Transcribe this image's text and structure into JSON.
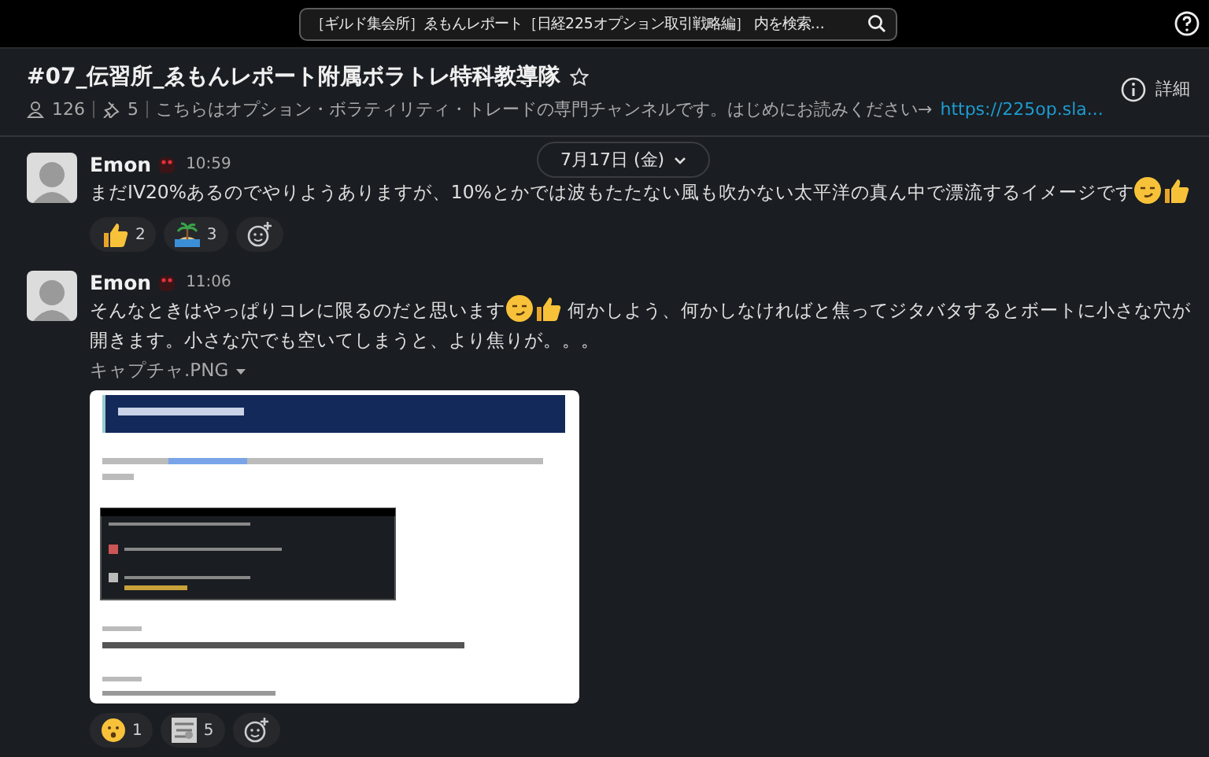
{
  "search": {
    "placeholder": "［ギルド集会所］ゑもんレポート［日経225オプション取引戦略編］ 内を検索..."
  },
  "channel": {
    "name": "#07_伝習所_ゑもんレポート附属ボラトレ特科教導隊",
    "starred": false,
    "members": "126",
    "pins": "5",
    "description": "こちらはオプション・ボラティリティ・トレードの専門チャンネルです。はじめにお読みください→",
    "link": "https://225op.sla...",
    "details_label": "詳細"
  },
  "date_divider": "7月17日 (金)",
  "messages": [
    {
      "author": "Emon",
      "time": "10:59",
      "segments": [
        {
          "kind": "text",
          "text": "まだIV20%あるのでやりようありますが、10%とかでは波もたたない風も吹かない太平洋の真ん中で漂流するイメージです"
        },
        {
          "kind": "smirk"
        },
        {
          "kind": "thumbs-up"
        }
      ],
      "reactions": [
        {
          "kind": "thumbs-up",
          "count": "2"
        },
        {
          "kind": "island",
          "count": "3"
        }
      ]
    },
    {
      "author": "Emon",
      "time": "11:06",
      "segments": [
        {
          "kind": "text",
          "text": "そんなときはやっぱりコレに限るのだと思います"
        },
        {
          "kind": "smirk"
        },
        {
          "kind": "thumbs-up"
        },
        {
          "kind": "text",
          "text": " 何かしよう、何かしなければと焦ってジタバタするとボートに小さな穴が開きます。小さな穴でも空いてしまうと、より焦りが。。。"
        }
      ],
      "attachment": {
        "filename": "キャプチャ.PNG"
      },
      "reactions": [
        {
          "kind": "hushed",
          "count": "1"
        },
        {
          "kind": "custom-image",
          "count": "5"
        }
      ]
    }
  ]
}
